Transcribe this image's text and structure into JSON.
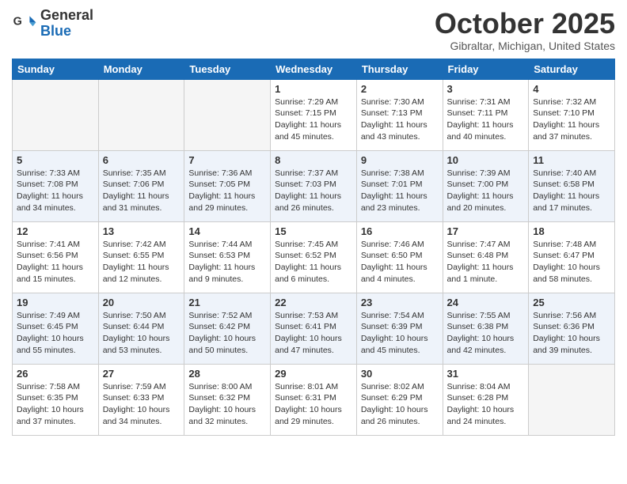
{
  "header": {
    "logo_general": "General",
    "logo_blue": "Blue",
    "title": "October 2025",
    "subtitle": "Gibraltar, Michigan, United States"
  },
  "weekdays": [
    "Sunday",
    "Monday",
    "Tuesday",
    "Wednesday",
    "Thursday",
    "Friday",
    "Saturday"
  ],
  "weeks": [
    {
      "rowClass": "row-week1",
      "days": [
        {
          "num": "",
          "info": "",
          "empty": true
        },
        {
          "num": "",
          "info": "",
          "empty": true
        },
        {
          "num": "",
          "info": "",
          "empty": true
        },
        {
          "num": "1",
          "info": "Sunrise: 7:29 AM\nSunset: 7:15 PM\nDaylight: 11 hours\nand 45 minutes.",
          "empty": false
        },
        {
          "num": "2",
          "info": "Sunrise: 7:30 AM\nSunset: 7:13 PM\nDaylight: 11 hours\nand 43 minutes.",
          "empty": false
        },
        {
          "num": "3",
          "info": "Sunrise: 7:31 AM\nSunset: 7:11 PM\nDaylight: 11 hours\nand 40 minutes.",
          "empty": false
        },
        {
          "num": "4",
          "info": "Sunrise: 7:32 AM\nSunset: 7:10 PM\nDaylight: 11 hours\nand 37 minutes.",
          "empty": false
        }
      ]
    },
    {
      "rowClass": "row-week2",
      "days": [
        {
          "num": "5",
          "info": "Sunrise: 7:33 AM\nSunset: 7:08 PM\nDaylight: 11 hours\nand 34 minutes.",
          "empty": false
        },
        {
          "num": "6",
          "info": "Sunrise: 7:35 AM\nSunset: 7:06 PM\nDaylight: 11 hours\nand 31 minutes.",
          "empty": false
        },
        {
          "num": "7",
          "info": "Sunrise: 7:36 AM\nSunset: 7:05 PM\nDaylight: 11 hours\nand 29 minutes.",
          "empty": false
        },
        {
          "num": "8",
          "info": "Sunrise: 7:37 AM\nSunset: 7:03 PM\nDaylight: 11 hours\nand 26 minutes.",
          "empty": false
        },
        {
          "num": "9",
          "info": "Sunrise: 7:38 AM\nSunset: 7:01 PM\nDaylight: 11 hours\nand 23 minutes.",
          "empty": false
        },
        {
          "num": "10",
          "info": "Sunrise: 7:39 AM\nSunset: 7:00 PM\nDaylight: 11 hours\nand 20 minutes.",
          "empty": false
        },
        {
          "num": "11",
          "info": "Sunrise: 7:40 AM\nSunset: 6:58 PM\nDaylight: 11 hours\nand 17 minutes.",
          "empty": false
        }
      ]
    },
    {
      "rowClass": "row-week3",
      "days": [
        {
          "num": "12",
          "info": "Sunrise: 7:41 AM\nSunset: 6:56 PM\nDaylight: 11 hours\nand 15 minutes.",
          "empty": false
        },
        {
          "num": "13",
          "info": "Sunrise: 7:42 AM\nSunset: 6:55 PM\nDaylight: 11 hours\nand 12 minutes.",
          "empty": false
        },
        {
          "num": "14",
          "info": "Sunrise: 7:44 AM\nSunset: 6:53 PM\nDaylight: 11 hours\nand 9 minutes.",
          "empty": false
        },
        {
          "num": "15",
          "info": "Sunrise: 7:45 AM\nSunset: 6:52 PM\nDaylight: 11 hours\nand 6 minutes.",
          "empty": false
        },
        {
          "num": "16",
          "info": "Sunrise: 7:46 AM\nSunset: 6:50 PM\nDaylight: 11 hours\nand 4 minutes.",
          "empty": false
        },
        {
          "num": "17",
          "info": "Sunrise: 7:47 AM\nSunset: 6:48 PM\nDaylight: 11 hours\nand 1 minute.",
          "empty": false
        },
        {
          "num": "18",
          "info": "Sunrise: 7:48 AM\nSunset: 6:47 PM\nDaylight: 10 hours\nand 58 minutes.",
          "empty": false
        }
      ]
    },
    {
      "rowClass": "row-week4",
      "days": [
        {
          "num": "19",
          "info": "Sunrise: 7:49 AM\nSunset: 6:45 PM\nDaylight: 10 hours\nand 55 minutes.",
          "empty": false
        },
        {
          "num": "20",
          "info": "Sunrise: 7:50 AM\nSunset: 6:44 PM\nDaylight: 10 hours\nand 53 minutes.",
          "empty": false
        },
        {
          "num": "21",
          "info": "Sunrise: 7:52 AM\nSunset: 6:42 PM\nDaylight: 10 hours\nand 50 minutes.",
          "empty": false
        },
        {
          "num": "22",
          "info": "Sunrise: 7:53 AM\nSunset: 6:41 PM\nDaylight: 10 hours\nand 47 minutes.",
          "empty": false
        },
        {
          "num": "23",
          "info": "Sunrise: 7:54 AM\nSunset: 6:39 PM\nDaylight: 10 hours\nand 45 minutes.",
          "empty": false
        },
        {
          "num": "24",
          "info": "Sunrise: 7:55 AM\nSunset: 6:38 PM\nDaylight: 10 hours\nand 42 minutes.",
          "empty": false
        },
        {
          "num": "25",
          "info": "Sunrise: 7:56 AM\nSunset: 6:36 PM\nDaylight: 10 hours\nand 39 minutes.",
          "empty": false
        }
      ]
    },
    {
      "rowClass": "row-week5",
      "days": [
        {
          "num": "26",
          "info": "Sunrise: 7:58 AM\nSunset: 6:35 PM\nDaylight: 10 hours\nand 37 minutes.",
          "empty": false
        },
        {
          "num": "27",
          "info": "Sunrise: 7:59 AM\nSunset: 6:33 PM\nDaylight: 10 hours\nand 34 minutes.",
          "empty": false
        },
        {
          "num": "28",
          "info": "Sunrise: 8:00 AM\nSunset: 6:32 PM\nDaylight: 10 hours\nand 32 minutes.",
          "empty": false
        },
        {
          "num": "29",
          "info": "Sunrise: 8:01 AM\nSunset: 6:31 PM\nDaylight: 10 hours\nand 29 minutes.",
          "empty": false
        },
        {
          "num": "30",
          "info": "Sunrise: 8:02 AM\nSunset: 6:29 PM\nDaylight: 10 hours\nand 26 minutes.",
          "empty": false
        },
        {
          "num": "31",
          "info": "Sunrise: 8:04 AM\nSunset: 6:28 PM\nDaylight: 10 hours\nand 24 minutes.",
          "empty": false
        },
        {
          "num": "",
          "info": "",
          "empty": true
        }
      ]
    }
  ]
}
